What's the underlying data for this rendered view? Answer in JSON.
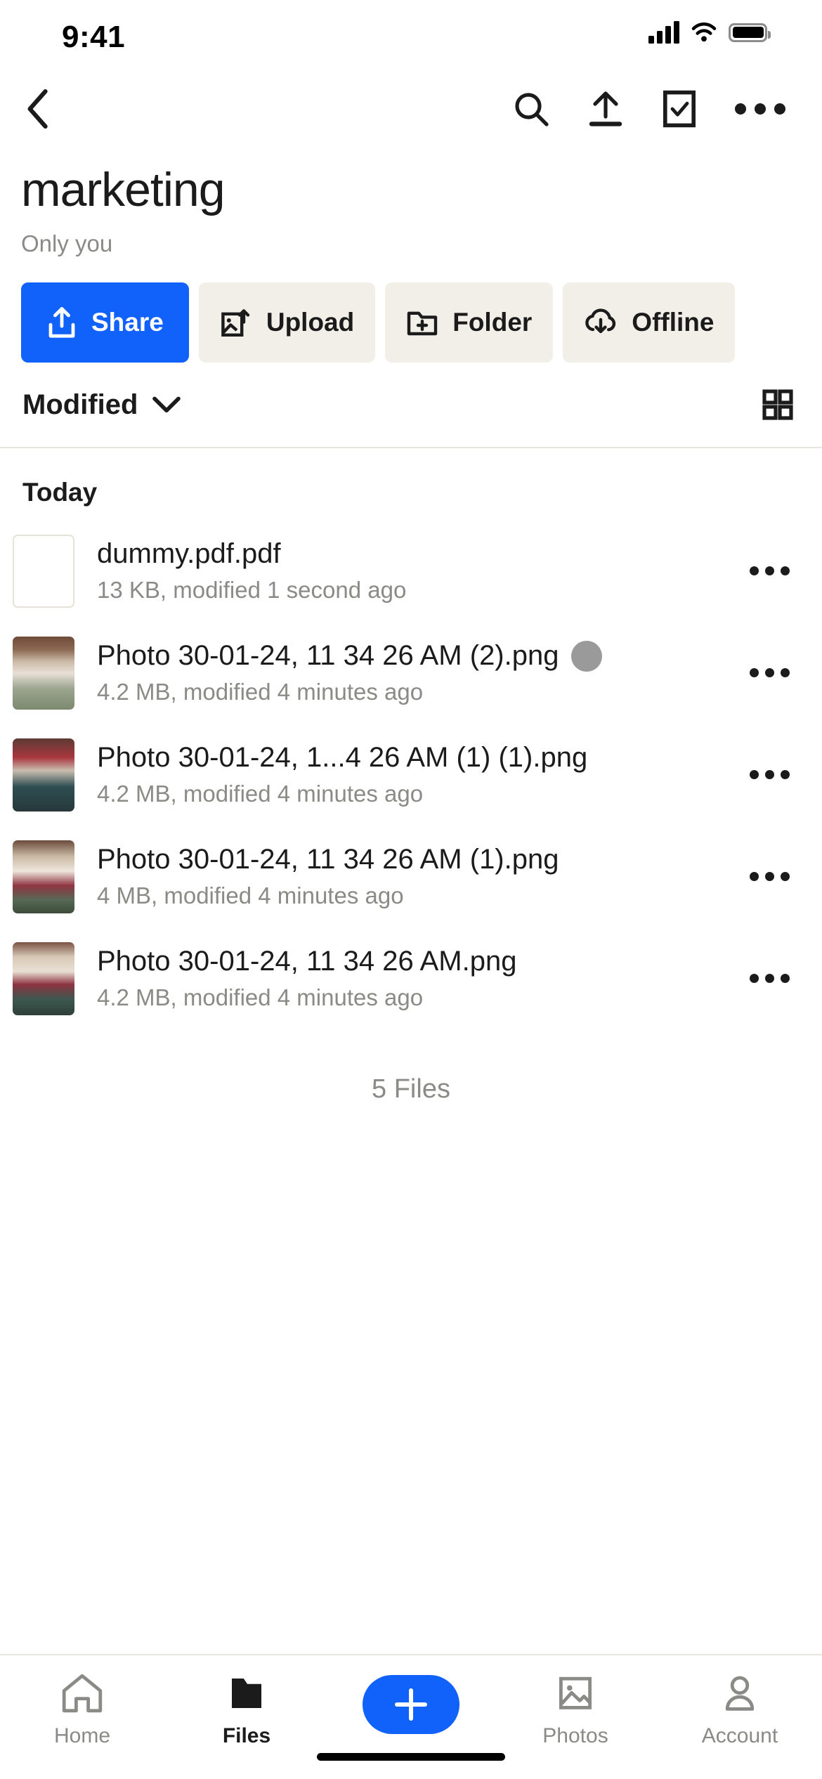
{
  "status_bar": {
    "time": "9:41",
    "cellular_icon": "cellular-signal-icon",
    "wifi_icon": "wifi-icon",
    "battery_icon": "battery-icon"
  },
  "nav_bar": {
    "back_icon": "back-chevron-icon",
    "search_icon": "search-icon",
    "upload_icon": "upload-icon",
    "select_icon": "checkbox-select-icon",
    "more_icon": "more-horizontal-icon"
  },
  "header": {
    "title": "marketing",
    "subtitle": "Only you"
  },
  "actions": [
    {
      "label": "Share",
      "icon": "share-icon",
      "primary": true
    },
    {
      "label": "Upload",
      "icon": "image-upload-icon",
      "primary": false
    },
    {
      "label": "Folder",
      "icon": "folder-plus-icon",
      "primary": false
    },
    {
      "label": "Offline",
      "icon": "cloud-download-icon",
      "primary": false
    }
  ],
  "sort_bar": {
    "sort_label": "Modified",
    "chevron_icon": "chevron-down-icon",
    "view_toggle_icon": "grid-view-icon"
  },
  "list": {
    "group_header": "Today",
    "files": [
      {
        "name": "dummy.pdf.pdf",
        "meta": "13 KB, modified 1 second ago",
        "thumb": "empty",
        "badge": false,
        "more_icon": "more-horizontal-icon"
      },
      {
        "name": "Photo 30-01-24, 11 34 26 AM (2).png",
        "meta": "4.2 MB, modified 4 minutes ago",
        "thumb": "photo-1",
        "badge": true,
        "more_icon": "more-horizontal-icon"
      },
      {
        "name": "Photo 30-01-24, 1...4 26 AM (1) (1).png",
        "meta": "4.2 MB, modified 4 minutes ago",
        "thumb": "photo-2",
        "badge": false,
        "more_icon": "more-horizontal-icon"
      },
      {
        "name": "Photo 30-01-24, 11 34 26 AM (1).png",
        "meta": "4 MB, modified 4 minutes ago",
        "thumb": "photo-3",
        "badge": false,
        "more_icon": "more-horizontal-icon"
      },
      {
        "name": "Photo 30-01-24, 11 34 26 AM.png",
        "meta": "4.2 MB, modified 4 minutes ago",
        "thumb": "photo-4",
        "badge": false,
        "more_icon": "more-horizontal-icon"
      }
    ],
    "file_count": "5 Files"
  },
  "tab_bar": {
    "tabs": [
      {
        "label": "Home",
        "icon": "home-icon",
        "active": false
      },
      {
        "label": "Files",
        "icon": "folder-icon",
        "active": true
      },
      {
        "label": "Photos",
        "icon": "photos-icon",
        "active": false
      },
      {
        "label": "Account",
        "icon": "person-icon",
        "active": false
      }
    ],
    "fab_icon": "plus-icon"
  },
  "colors": {
    "accent": "#1161fb",
    "pill_bg": "#f2efe9",
    "text_primary": "#1b1b1b",
    "text_secondary": "#8a8a86",
    "divider": "#e8e5de",
    "badge_gray": "#9a9a9a"
  }
}
